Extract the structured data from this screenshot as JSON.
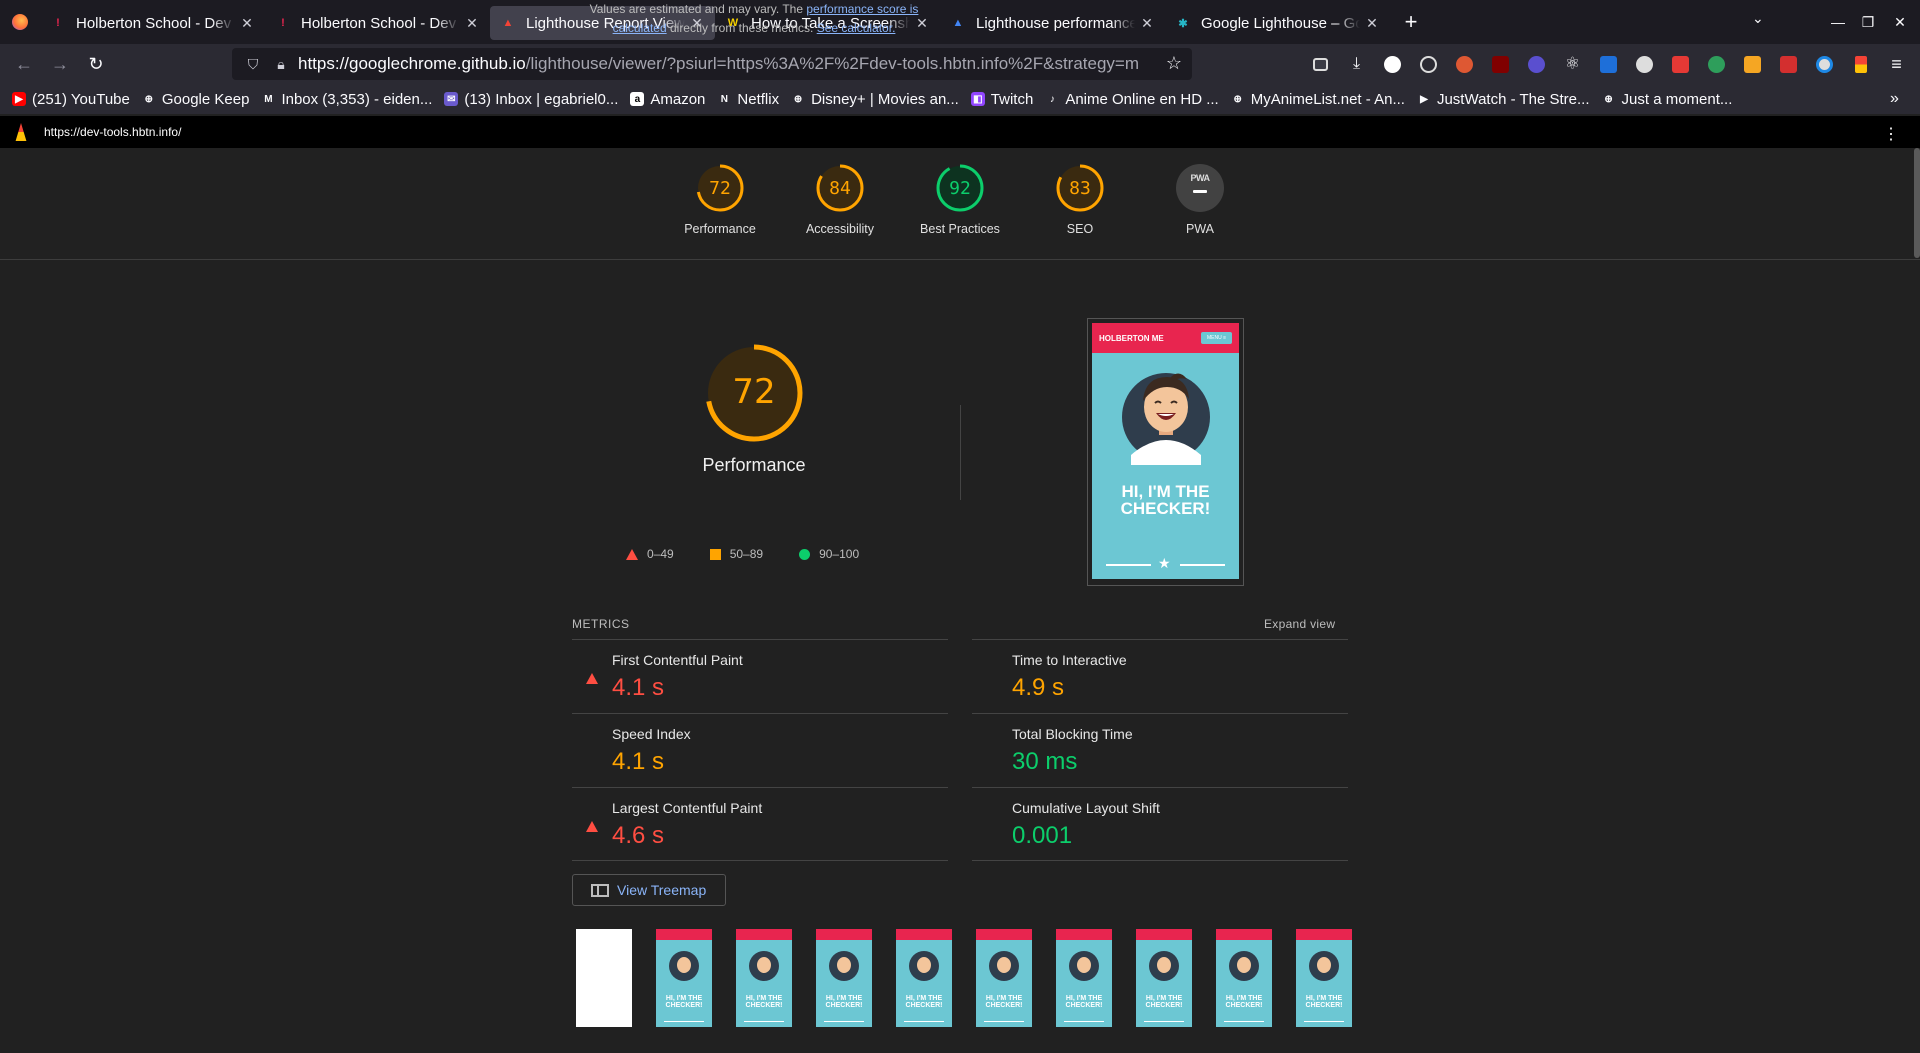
{
  "browser": {
    "tabs": [
      {
        "title": "Holberton School - Dev",
        "fav_color": "#e8254f",
        "fav_glyph": "ǃ"
      },
      {
        "title": "Holberton School - Dev",
        "fav_color": "#e8254f",
        "fav_glyph": "ǃ"
      },
      {
        "title": "Lighthouse Report Viewer",
        "fav_color": "#f44336",
        "fav_glyph": "▲",
        "active": true
      },
      {
        "title": "How to Take a Screenshot",
        "fav_color": "#f5d000",
        "fav_glyph": "W"
      },
      {
        "title": "Lighthouse performance",
        "fav_color": "#4285f4",
        "fav_glyph": "▲"
      },
      {
        "title": "Google Lighthouse – Go",
        "fav_color": "#26b7c7",
        "fav_glyph": "✱"
      }
    ],
    "url_host": "https://googlechrome.github.io",
    "url_rest": "/lighthouse/viewer/?psiurl=https%3A%2F%2Fdev-tools.hbtn.info%2F&strategy=m",
    "bookmarks": [
      {
        "label": "(251) YouTube",
        "color": "#ff0000",
        "glyph": "▶"
      },
      {
        "label": "Google Keep",
        "color": "#2b2a33",
        "glyph": "⊕"
      },
      {
        "label": "Inbox (3,353) - eiden...",
        "color": "#2b2a33",
        "glyph": "M"
      },
      {
        "label": "(13) Inbox | egabriel0...",
        "color": "#6a5acd",
        "glyph": "✉"
      },
      {
        "label": "Amazon",
        "color": "#ffffff",
        "glyph": "a"
      },
      {
        "label": "Netflix",
        "color": "#2b2a33",
        "glyph": "N"
      },
      {
        "label": "Disney+ | Movies an...",
        "color": "#2b2a33",
        "glyph": "⊕"
      },
      {
        "label": "Twitch",
        "color": "#9146ff",
        "glyph": "◧"
      },
      {
        "label": "Anime Online en HD ...",
        "color": "#2b2a33",
        "glyph": "♪"
      },
      {
        "label": "MyAnimeList.net - An...",
        "color": "#2b2a33",
        "glyph": "⊕"
      },
      {
        "label": "JustWatch - The Stre...",
        "color": "#2b2a33",
        "glyph": "▶"
      },
      {
        "label": "Just a moment...",
        "color": "#2b2a33",
        "glyph": "⊕"
      }
    ]
  },
  "lighthouse": {
    "report_url": "https://dev-tools.hbtn.info/",
    "categories": [
      {
        "label": "Performance",
        "score": "72",
        "status": "orange"
      },
      {
        "label": "Accessibility",
        "score": "84",
        "status": "orange"
      },
      {
        "label": "Best Practices",
        "score": "92",
        "status": "green"
      },
      {
        "label": "SEO",
        "score": "83",
        "status": "orange"
      },
      {
        "label": "PWA",
        "score": "",
        "status": "pwa"
      }
    ],
    "pwa_badge_text": "PWA",
    "performance": {
      "score": "72",
      "title": "Performance",
      "desc_prefix": "Values are estimated and may vary. The ",
      "desc_link": "performance score is calculated",
      "desc_mid": " directly from these metrics. ",
      "desc_link2": "See calculator.",
      "legend": [
        {
          "range": "0–49",
          "shape": "triangle"
        },
        {
          "range": "50–89",
          "shape": "square"
        },
        {
          "range": "90–100",
          "shape": "circle"
        }
      ]
    },
    "screenshot": {
      "header_brand": "HOLBERTON ME",
      "menu_label": "MENU ≡",
      "headline_1": "HI, I'M THE",
      "headline_2": "CHECKER!"
    },
    "metrics_heading": "METRICS",
    "expand_label": "Expand view",
    "metrics": [
      {
        "name": "First Contentful Paint",
        "value": "4.1 s",
        "status": "red"
      },
      {
        "name": "Time to Interactive",
        "value": "4.9 s",
        "status": "orange"
      },
      {
        "name": "Speed Index",
        "value": "4.1 s",
        "status": "orange"
      },
      {
        "name": "Total Blocking Time",
        "value": "30 ms",
        "status": "green"
      },
      {
        "name": "Largest Contentful Paint",
        "value": "4.6 s",
        "status": "red"
      },
      {
        "name": "Cumulative Layout Shift",
        "value": "0.001",
        "status": "green"
      }
    ],
    "treemap_label": "View Treemap",
    "filmstrip_text": "HI, I'M THE CHECKER!",
    "colors": {
      "red": "#ff4e42",
      "orange": "#ffa400",
      "green": "#0cce6b"
    }
  }
}
